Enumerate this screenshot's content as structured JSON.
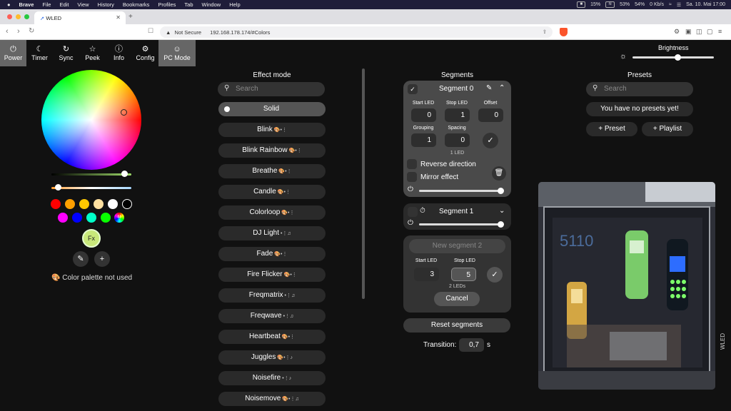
{
  "menubar": {
    "apple": "",
    "items": [
      "Brave",
      "File",
      "Edit",
      "View",
      "History",
      "Bookmarks",
      "Profiles",
      "Tab",
      "Window",
      "Help"
    ],
    "cpu": "15%",
    "ram": "53%",
    "ssd": "54%",
    "net_up": "0 Kb/s",
    "net_down": "0 Kb/s",
    "clock": "Sa. 10. Mai  17:00"
  },
  "browser": {
    "tab_title": "WLED",
    "security_label": "Not Secure",
    "url": "192.168.178.174/#Colors"
  },
  "nav": {
    "items": [
      {
        "icon": "power-icon",
        "label": "Power"
      },
      {
        "icon": "moon-icon",
        "label": "Timer"
      },
      {
        "icon": "sync-icon",
        "label": "Sync"
      },
      {
        "icon": "star-icon",
        "label": "Peek"
      },
      {
        "icon": "info-icon",
        "label": "Info"
      },
      {
        "icon": "gear-icon",
        "label": "Config"
      },
      {
        "icon": "smiley-icon",
        "label": "PC Mode"
      }
    ]
  },
  "brightness": {
    "label": "Brightness",
    "level": 0.55
  },
  "colors": {
    "swatches_row1": [
      "#ff0000",
      "#ffa000",
      "#ffc800",
      "#ffe0a0",
      "#ffffff",
      "#000000"
    ],
    "swatches_row2": [
      "#ff00ff",
      "#0000ff",
      "#00ffc8",
      "#08ff00"
    ],
    "fx_label": "Fx",
    "palette_note": "Color palette not used"
  },
  "effects": {
    "title": "Effect mode",
    "search_placeholder": "Search",
    "items": [
      {
        "name": "Solid",
        "flags": ""
      },
      {
        "name": "Blink",
        "flags": "🎨•⋮"
      },
      {
        "name": "Blink Rainbow",
        "flags": "🎨•⋮"
      },
      {
        "name": "Breathe",
        "flags": "🎨•⋮"
      },
      {
        "name": "Candle",
        "flags": "🎨•⋮"
      },
      {
        "name": "Colorloop",
        "flags": "🎨•⋮"
      },
      {
        "name": "DJ Light",
        "flags": "•⋮♫"
      },
      {
        "name": "Fade",
        "flags": "🎨•⋮"
      },
      {
        "name": "Fire Flicker",
        "flags": "🎨•⋮"
      },
      {
        "name": "Freqmatrix",
        "flags": "•⋮♫"
      },
      {
        "name": "Freqwave",
        "flags": "•⋮♫"
      },
      {
        "name": "Heartbeat",
        "flags": "🎨•⋮"
      },
      {
        "name": "Juggles",
        "flags": "🎨•⋮♪"
      },
      {
        "name": "Noisefire",
        "flags": "•⋮♪"
      },
      {
        "name": "Noisemove",
        "flags": "🎨•⋮♫"
      }
    ]
  },
  "segments": {
    "title": "Segments",
    "seg0": {
      "name": "Segment 0",
      "labels": {
        "start": "Start LED",
        "stop": "Stop LED",
        "offset": "Offset",
        "grouping": "Grouping",
        "spacing": "Spacing"
      },
      "start": "0",
      "stop": "1",
      "offset": "0",
      "grouping": "1",
      "spacing": "0",
      "led_count": "1 LED",
      "reverse": "Reverse direction",
      "mirror": "Mirror effect"
    },
    "seg1": {
      "name": "Segment 1"
    },
    "new_seg": {
      "name": "New segment 2",
      "start_label": "Start LED",
      "stop_label": "Stop LED",
      "start": "3",
      "stop": "5",
      "led_count": "2 LEDs",
      "cancel": "Cancel"
    },
    "reset": "Reset segments",
    "transition_label": "Transition:",
    "transition_value": "0,7",
    "transition_unit": "s"
  },
  "presets": {
    "title": "Presets",
    "search_placeholder": "Search",
    "empty": "You have no presets yet!",
    "add_preset": "Preset",
    "add_playlist": "Playlist"
  },
  "side_label": "WLED"
}
